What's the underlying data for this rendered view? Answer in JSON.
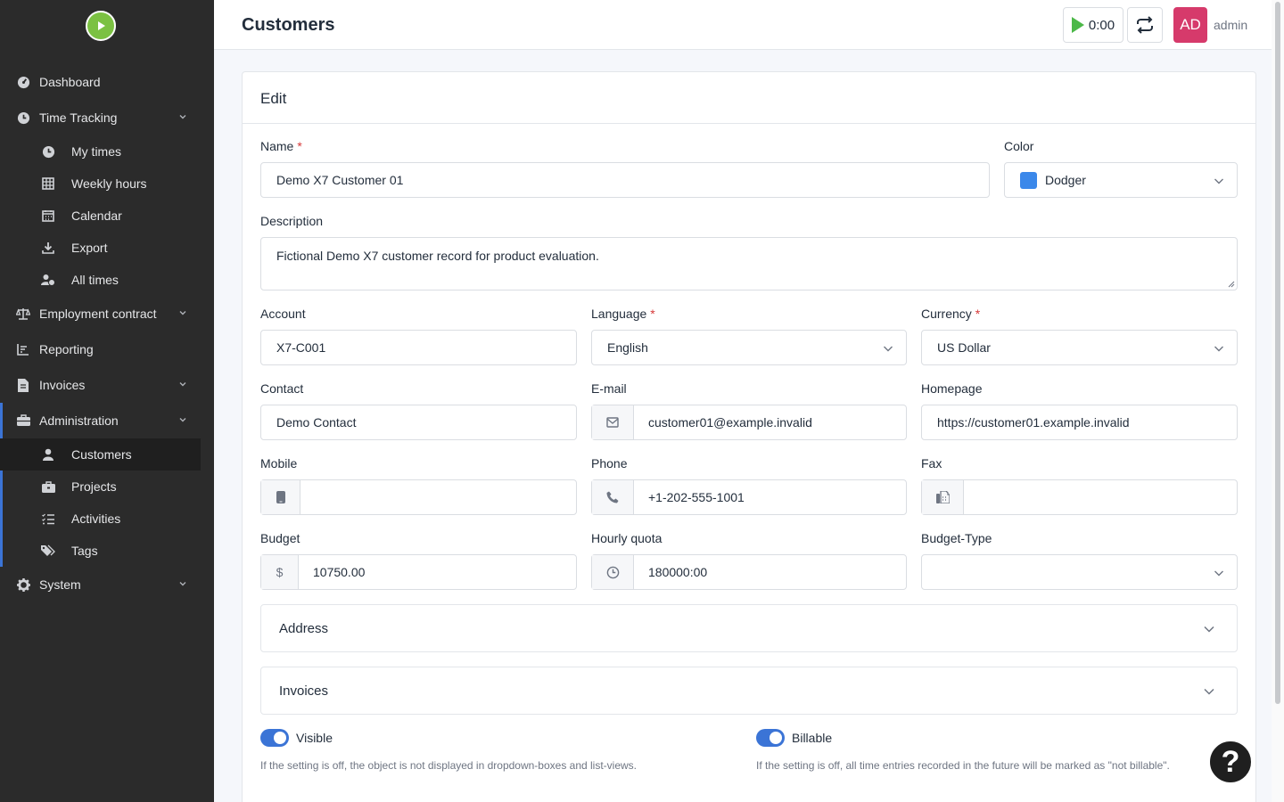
{
  "sidebar": {
    "items": [
      {
        "label": "Dashboard",
        "icon": "dashboard-icon"
      },
      {
        "label": "Time Tracking",
        "icon": "clock-icon"
      },
      {
        "label": "My times",
        "icon": "clock-icon"
      },
      {
        "label": "Weekly hours",
        "icon": "table-icon"
      },
      {
        "label": "Calendar",
        "icon": "calendar-icon"
      },
      {
        "label": "Export",
        "icon": "download-icon"
      },
      {
        "label": "All times",
        "icon": "users-clock-icon"
      },
      {
        "label": "Employment contract",
        "icon": "balance-scale-icon"
      },
      {
        "label": "Reporting",
        "icon": "chart-icon"
      },
      {
        "label": "Invoices",
        "icon": "invoice-icon"
      },
      {
        "label": "Administration",
        "icon": "toolbox-icon"
      },
      {
        "label": "Customers",
        "icon": "user-icon"
      },
      {
        "label": "Projects",
        "icon": "briefcase-icon"
      },
      {
        "label": "Activities",
        "icon": "list-icon"
      },
      {
        "label": "Tags",
        "icon": "tags-icon"
      },
      {
        "label": "System",
        "icon": "gear-icon"
      }
    ]
  },
  "header": {
    "title": "Customers",
    "timer": "0:00",
    "avatar_initials": "AD",
    "username": "admin"
  },
  "card": {
    "title": "Edit"
  },
  "form": {
    "name": {
      "label": "Name",
      "required": "*",
      "value": "Demo X7 Customer 01"
    },
    "color": {
      "label": "Color",
      "value": "Dodger",
      "swatch": "#3b88ea"
    },
    "description": {
      "label": "Description",
      "value": "Fictional Demo X7 customer record for product evaluation."
    },
    "account": {
      "label": "Account",
      "value": "X7-C001"
    },
    "language": {
      "label": "Language",
      "required": "*",
      "value": "English"
    },
    "currency": {
      "label": "Currency",
      "required": "*",
      "value": "US Dollar"
    },
    "contact": {
      "label": "Contact",
      "value": "Demo Contact"
    },
    "email": {
      "label": "E-mail",
      "value": "customer01@example.invalid"
    },
    "homepage": {
      "label": "Homepage",
      "value": "https://customer01.example.invalid"
    },
    "mobile": {
      "label": "Mobile",
      "value": ""
    },
    "phone": {
      "label": "Phone",
      "value": "+1-202-555-1001"
    },
    "fax": {
      "label": "Fax",
      "value": ""
    },
    "budget": {
      "label": "Budget",
      "prefix": "$",
      "value": "10750.00"
    },
    "hourly_quota": {
      "label": "Hourly quota",
      "value": "180000:00"
    },
    "budget_type": {
      "label": "Budget-Type",
      "value": ""
    },
    "address_panel": "Address",
    "invoices_panel": "Invoices",
    "visible": {
      "label": "Visible",
      "checked": true,
      "hint": "If the setting is off, the object is not displayed in dropdown-boxes and list-views."
    },
    "billable": {
      "label": "Billable",
      "checked": true,
      "hint": "If the setting is off, all time entries recorded in the future will be marked as \"not billable\"."
    }
  },
  "help_button": "?",
  "colors": {
    "sidebar_bg": "#2b2b2b",
    "accent": "#3b74d6",
    "avatar_bg": "#d63a6b",
    "play_green": "#4cb848",
    "logo_green": "#7bc142"
  }
}
